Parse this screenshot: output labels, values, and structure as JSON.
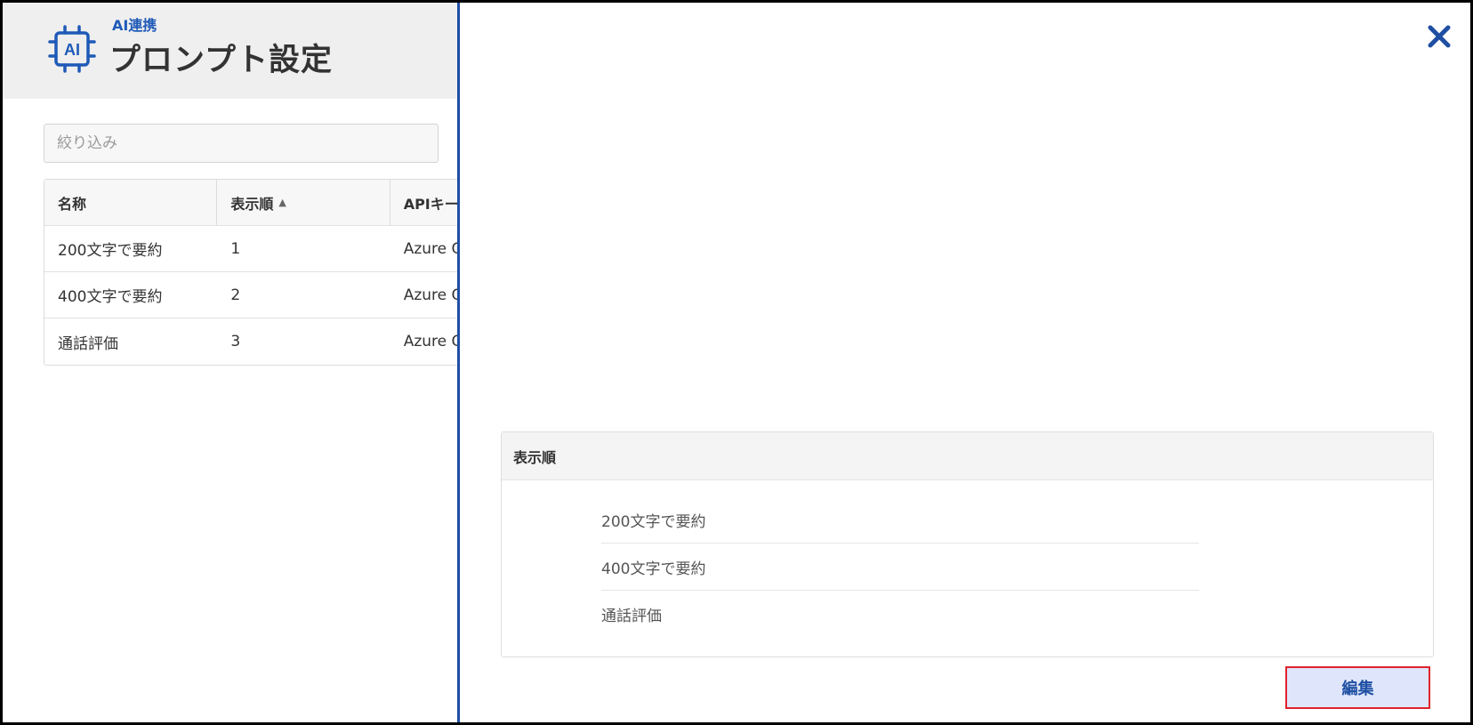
{
  "header": {
    "breadcrumb": "AI連携",
    "title": "プロンプト設定",
    "icon": "ai-chip-icon",
    "icon_label": "AI"
  },
  "filter": {
    "placeholder": "絞り込み"
  },
  "table": {
    "columns": [
      "名称",
      "表示順",
      "APIキー"
    ],
    "sort_indicator": "▲",
    "rows": [
      {
        "name": "200文字で要約",
        "order": "1",
        "api": "Azure O"
      },
      {
        "name": "400文字で要約",
        "order": "2",
        "api": "Azure O"
      },
      {
        "name": "通話評価",
        "order": "3",
        "api": "Azure O"
      }
    ]
  },
  "panel": {
    "close_icon": "close-icon",
    "order_section": {
      "title": "表示順",
      "items": [
        "200文字で要約",
        "400文字で要約",
        "通話評価"
      ]
    },
    "edit_label": "編集"
  },
  "colors": {
    "accent_blue": "#1f5ab8",
    "panel_border": "#1f4fa3",
    "highlight_red": "#e0222d",
    "button_bg": "#dfe6fb"
  }
}
